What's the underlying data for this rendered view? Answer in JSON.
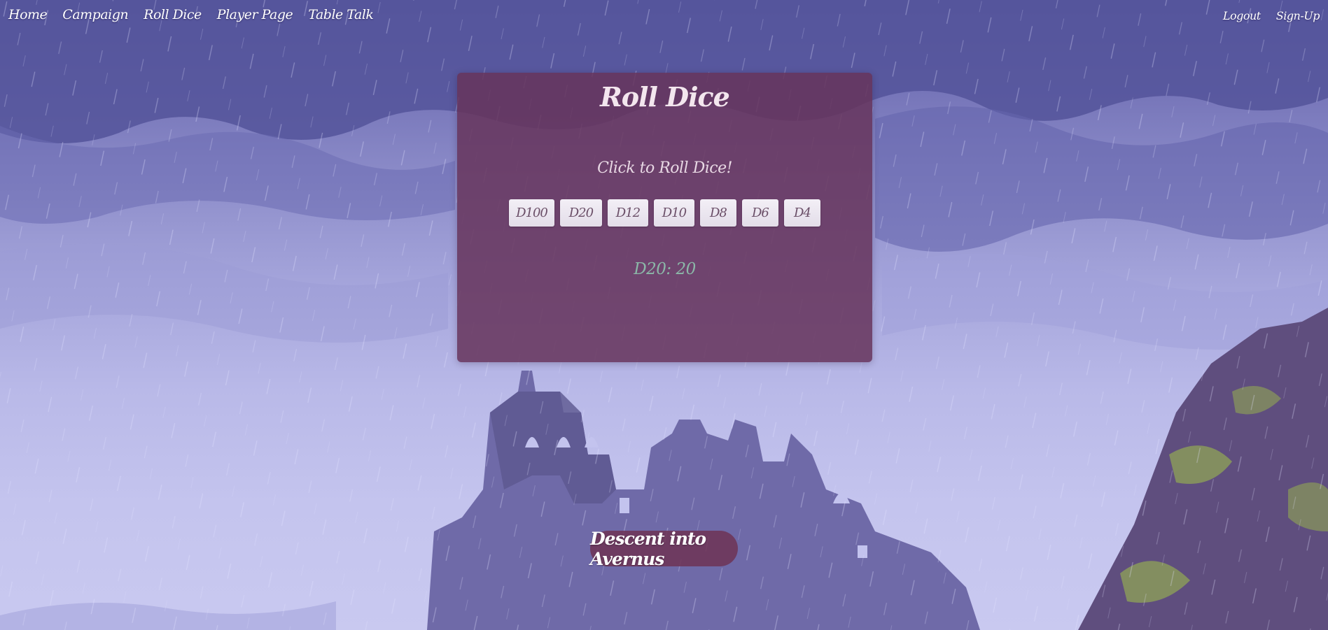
{
  "nav": {
    "left": [
      {
        "id": "home",
        "label": "Home"
      },
      {
        "id": "campaign",
        "label": "Campaign"
      },
      {
        "id": "roll-dice",
        "label": "Roll Dice"
      },
      {
        "id": "player-page",
        "label": "Player Page"
      },
      {
        "id": "table-talk",
        "label": "Table Talk"
      }
    ],
    "right": [
      {
        "id": "logout",
        "label": "Logout"
      },
      {
        "id": "sign-up",
        "label": "Sign-Up"
      }
    ]
  },
  "roller": {
    "title": "Roll Dice",
    "instruction": "Click to Roll Dice!",
    "dice": [
      {
        "id": "d100",
        "label": "D100"
      },
      {
        "id": "d20",
        "label": "D20"
      },
      {
        "id": "d12",
        "label": "D12"
      },
      {
        "id": "d10",
        "label": "D10"
      },
      {
        "id": "d8",
        "label": "D8"
      },
      {
        "id": "d6",
        "label": "D6"
      },
      {
        "id": "d4",
        "label": "D4"
      }
    ],
    "result": "D20: 20"
  },
  "campaign": {
    "name": "Descent into Avernus"
  },
  "colors": {
    "card_background": "#66345c",
    "result_text": "#8bb8a8",
    "sky_top": "#5f5fa8",
    "sky_bottom": "#c9c9f0"
  }
}
